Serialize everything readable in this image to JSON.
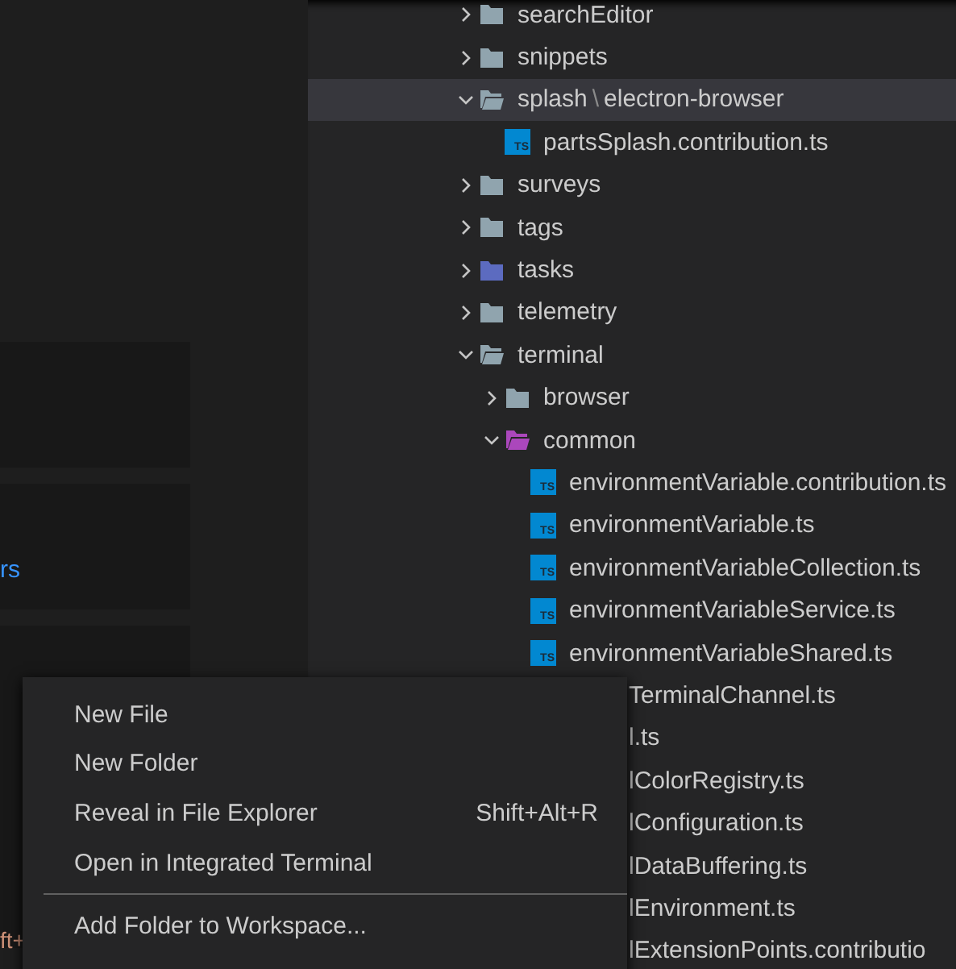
{
  "editor": {
    "link_text": "rs",
    "shortcut_fragment": "ft+"
  },
  "explorer": {
    "tree": [
      {
        "kind": "folder",
        "name": "searchEditor",
        "expanded": false,
        "selected": false,
        "color": "#90a4ae"
      },
      {
        "kind": "folder",
        "name": "snippets",
        "expanded": false,
        "selected": false,
        "color": "#90a4ae"
      },
      {
        "kind": "folder",
        "name": "splash",
        "separator": "\\",
        "suffix": "electron-browser",
        "expanded": true,
        "selected": true,
        "color": "#90a4ae",
        "children": [
          {
            "kind": "file",
            "name": "partsSplash.contribution.ts",
            "badge": "TS",
            "selected": false
          }
        ]
      },
      {
        "kind": "folder",
        "name": "surveys",
        "expanded": false,
        "selected": false,
        "color": "#90a4ae"
      },
      {
        "kind": "folder",
        "name": "tags",
        "expanded": false,
        "selected": false,
        "color": "#90a4ae"
      },
      {
        "kind": "folder",
        "name": "tasks",
        "expanded": false,
        "selected": false,
        "color": "#5c6bc0"
      },
      {
        "kind": "folder",
        "name": "telemetry",
        "expanded": false,
        "selected": false,
        "color": "#90a4ae"
      },
      {
        "kind": "folder",
        "name": "terminal",
        "expanded": true,
        "selected": false,
        "color": "#90a4ae",
        "children": [
          {
            "kind": "folder",
            "name": "browser",
            "expanded": false,
            "selected": false,
            "color": "#90a4ae"
          },
          {
            "kind": "folder",
            "name": "common",
            "expanded": true,
            "selected": false,
            "color": "#ab47bc",
            "children": [
              {
                "kind": "file",
                "name": "environmentVariable.contribution.ts",
                "badge": "TS",
                "selected": false
              },
              {
                "kind": "file",
                "name": "environmentVariable.ts",
                "badge": "TS",
                "selected": false
              },
              {
                "kind": "file",
                "name": "environmentVariableCollection.ts",
                "badge": "TS",
                "selected": false
              },
              {
                "kind": "file",
                "name": "environmentVariableService.ts",
                "badge": "TS",
                "selected": false
              },
              {
                "kind": "file",
                "name": "environmentVariableShared.ts",
                "badge": "TS",
                "selected": false
              },
              {
                "kind": "partial",
                "name": "TerminalChannel.ts"
              },
              {
                "kind": "partial",
                "name": "l.ts"
              },
              {
                "kind": "partial",
                "name": "lColorRegistry.ts"
              },
              {
                "kind": "partial",
                "name": "lConfiguration.ts"
              },
              {
                "kind": "partial",
                "name": "lDataBuffering.ts"
              },
              {
                "kind": "partial",
                "name": "lEnvironment.ts"
              },
              {
                "kind": "partial",
                "name": "lExtensionPoints.contributio"
              }
            ]
          }
        ]
      }
    ]
  },
  "context_menu": {
    "items": [
      {
        "kind": "item",
        "label": "New File"
      },
      {
        "kind": "item",
        "label": "New Folder"
      },
      {
        "kind": "item",
        "label": "Reveal in File Explorer",
        "shortcut": "Shift+Alt+R"
      },
      {
        "kind": "item",
        "label": "Open in Integrated Terminal"
      },
      {
        "kind": "separator"
      },
      {
        "kind": "item",
        "label": "Add Folder to Workspace..."
      }
    ]
  }
}
